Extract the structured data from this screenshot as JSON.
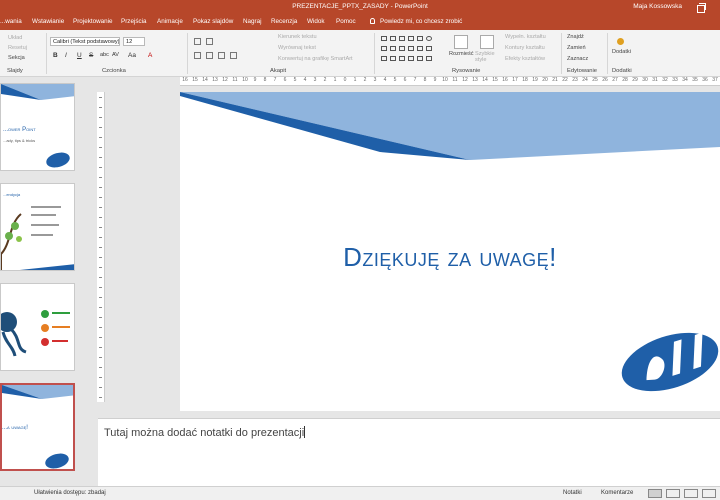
{
  "window": {
    "title": "PREZENTACJE_PPTX_ZASADY  -  PowerPoint",
    "user": "Maja Kossowska"
  },
  "tabs": [
    "...wania",
    "Wstawianie",
    "Projektowanie",
    "Przejścia",
    "Animacje",
    "Pokaz slajdów",
    "Nagraj",
    "Recenzja",
    "Widok",
    "Pomoc"
  ],
  "tell_me": "Powiedz mi, co chcesz zrobić",
  "ribbon": {
    "clipboard": {
      "items": [
        "Układ",
        "Resetuj",
        "Sekcja"
      ],
      "label": "Slajdy"
    },
    "font": {
      "name": "Calibri (Tekst podstawowy)",
      "size": "12",
      "buttons": [
        "B",
        "I",
        "U",
        "S",
        "abc",
        "AV",
        "Aa",
        "A"
      ],
      "label": "Czcionka"
    },
    "paragraph": {
      "items": [
        "Kierunek tekstu",
        "Wyrównaj tekst",
        "Konwertuj na grafikę SmartArt"
      ],
      "label": "Akapit"
    },
    "drawing": {
      "arrange": "Rozmieść",
      "quick_styles": "Szybkie style",
      "items": [
        "Wypełn. kształtu",
        "Kontury kształtu",
        "Efekty kształtów"
      ],
      "label": "Rysowanie"
    },
    "editing": {
      "items": [
        "Znajdź",
        "Zamień",
        "Zaznacz"
      ],
      "label": "Edytowanie"
    },
    "addins": {
      "button": "Dodatki",
      "label": "Dodatki"
    }
  },
  "ruler_ticks": [
    "16",
    "15",
    "14",
    "13",
    "12",
    "11",
    "10",
    "9",
    "8",
    "7",
    "6",
    "5",
    "4",
    "3",
    "2",
    "1",
    "0",
    "1",
    "2",
    "3",
    "4",
    "5",
    "6",
    "7",
    "8",
    "9",
    "10",
    "11",
    "12",
    "13",
    "14",
    "15",
    "16",
    "17",
    "18",
    "19",
    "20",
    "21",
    "22",
    "23",
    "24",
    "25",
    "26",
    "27",
    "28",
    "29",
    "30",
    "31",
    "32",
    "33",
    "34",
    "35",
    "36",
    "37",
    "38",
    "39",
    "40",
    "41",
    "42"
  ],
  "thumbnails": [
    {
      "title": "...ower Point",
      "subtitle": "...ady, tips & tricks"
    },
    {
      "title": "...endycja"
    },
    {
      "title": ""
    },
    {
      "title": "...a uwagę!",
      "selected": true
    }
  ],
  "slide": {
    "title": "Dziękuję za uwagę!"
  },
  "notes": {
    "placeholder": "Tutaj można dodać notatki do prezentacji"
  },
  "status": {
    "accessibility": "Ułatwienia dostępu: zbadaj",
    "notes": "Notatki",
    "comments": "Komentarze"
  },
  "colors": {
    "accent": "#b7472a",
    "slide_blue_dark": "#1f5fa8",
    "slide_blue_light": "#8fb4dd"
  }
}
